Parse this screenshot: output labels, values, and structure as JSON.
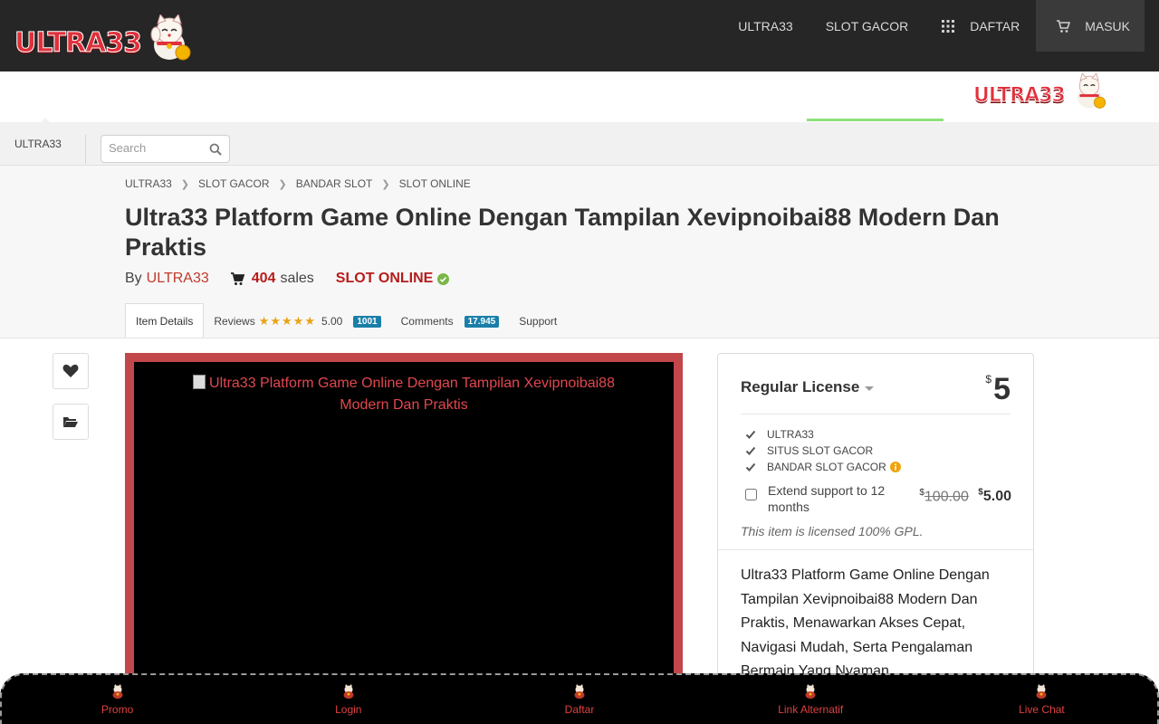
{
  "header": {
    "brand": "ULTRA33",
    "nav": [
      {
        "label": "ULTRA33"
      },
      {
        "label": "SLOT GACOR"
      },
      {
        "label": "DAFTAR",
        "icon": "grid-icon"
      },
      {
        "label": "MASUK",
        "icon": "cart-icon"
      }
    ]
  },
  "band": {
    "brand": "ULTRA33"
  },
  "subbar": {
    "brand": "ULTRA33",
    "search_placeholder": "Search"
  },
  "breadcrumb": [
    "ULTRA33",
    "SLOT GACOR",
    "BANDAR SLOT",
    "SLOT ONLINE"
  ],
  "item": {
    "title": "Ultra33 Platform Game Online Dengan Tampilan Xevipnoibai88 Modern Dan Praktis",
    "by_label": "By",
    "author": "ULTRA33",
    "sales_count": "404",
    "sales_label": "sales",
    "category": "SLOT ONLINE"
  },
  "tabs": {
    "details": "Item Details",
    "reviews": "Reviews",
    "stars": "★★★★★",
    "rating": "5.00",
    "reviews_count": "1001",
    "comments": "Comments",
    "comments_count": "17.945",
    "support": "Support"
  },
  "preview": {
    "alt": "Ultra33 Platform Game Online Dengan Tampilan Xevipnoibai88 Modern Dan Praktis"
  },
  "buybox": {
    "license": "Regular License",
    "currency": "$",
    "price": "5",
    "features": [
      {
        "label": "ULTRA33"
      },
      {
        "label": "SITUS SLOT GACOR"
      },
      {
        "label": "BANDAR SLOT GACOR"
      }
    ],
    "extend_label": "Extend support to 12 months",
    "extend_old_price": "100.00",
    "extend_new_price": "5.00",
    "gpl_note": "This item is licensed 100% GPL.",
    "description": "Ultra33 Platform Game Online Dengan Tampilan Xevipnoibai88 Modern Dan Praktis, Menawarkan Akses Cepat, Navigasi Mudah, Serta Pengalaman Bermain Yang Nyaman."
  },
  "bottom_nav": [
    {
      "label": "Promo"
    },
    {
      "label": "Login"
    },
    {
      "label": "Daftar"
    },
    {
      "label": "Link Alternatif"
    },
    {
      "label": "Live Chat"
    }
  ],
  "colors": {
    "header_bg": "#262626",
    "accent_red": "#c1474b",
    "price_red": "#b71c1c",
    "badge_blue": "#1a7fa8",
    "star_gold": "#e8a317",
    "bottom_bar_bg": "#000000"
  }
}
